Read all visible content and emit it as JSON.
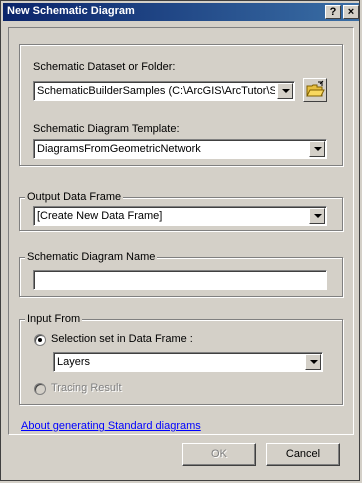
{
  "window": {
    "title": "New Schematic Diagram",
    "help_label": "?",
    "close_label": "×"
  },
  "dataset": {
    "label": "Schematic Dataset or Folder:",
    "value": "SchematicBuilderSamples (C:\\ArcGIS\\ArcTutor\\Sch"
  },
  "template": {
    "label": "Schematic Diagram Template:",
    "value": "DiagramsFromGeometricNetwork"
  },
  "output": {
    "group_label": "Output Data Frame",
    "value": "[Create New Data Frame]"
  },
  "name": {
    "group_label": "Schematic Diagram Name",
    "value": ""
  },
  "input": {
    "group_label": "Input From",
    "selection_label": "Selection set in Data Frame :",
    "selection_value": "Layers",
    "tracing_label": "Tracing Result"
  },
  "help_link": "About generating Standard diagrams",
  "buttons": {
    "ok": "OK",
    "cancel": "Cancel"
  }
}
